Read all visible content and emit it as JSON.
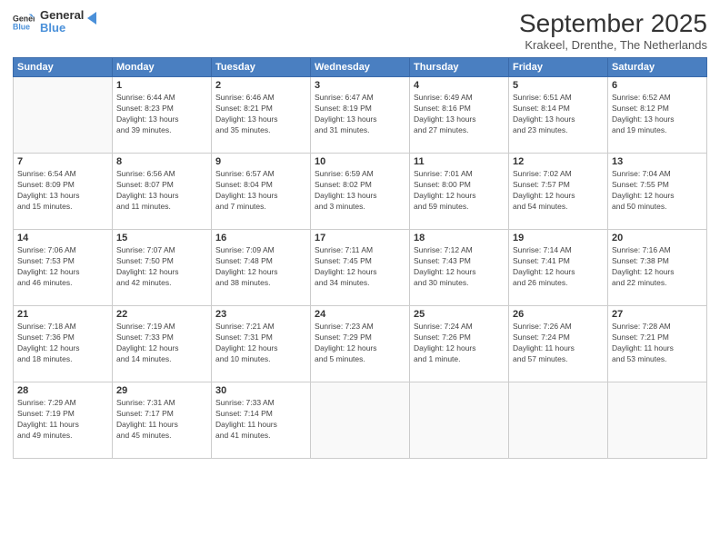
{
  "header": {
    "logo_line1": "General",
    "logo_line2": "Blue",
    "month": "September 2025",
    "location": "Krakeel, Drenthe, The Netherlands"
  },
  "days_of_week": [
    "Sunday",
    "Monday",
    "Tuesday",
    "Wednesday",
    "Thursday",
    "Friday",
    "Saturday"
  ],
  "weeks": [
    [
      {
        "day": "",
        "info": ""
      },
      {
        "day": "1",
        "info": "Sunrise: 6:44 AM\nSunset: 8:23 PM\nDaylight: 13 hours\nand 39 minutes."
      },
      {
        "day": "2",
        "info": "Sunrise: 6:46 AM\nSunset: 8:21 PM\nDaylight: 13 hours\nand 35 minutes."
      },
      {
        "day": "3",
        "info": "Sunrise: 6:47 AM\nSunset: 8:19 PM\nDaylight: 13 hours\nand 31 minutes."
      },
      {
        "day": "4",
        "info": "Sunrise: 6:49 AM\nSunset: 8:16 PM\nDaylight: 13 hours\nand 27 minutes."
      },
      {
        "day": "5",
        "info": "Sunrise: 6:51 AM\nSunset: 8:14 PM\nDaylight: 13 hours\nand 23 minutes."
      },
      {
        "day": "6",
        "info": "Sunrise: 6:52 AM\nSunset: 8:12 PM\nDaylight: 13 hours\nand 19 minutes."
      }
    ],
    [
      {
        "day": "7",
        "info": "Sunrise: 6:54 AM\nSunset: 8:09 PM\nDaylight: 13 hours\nand 15 minutes."
      },
      {
        "day": "8",
        "info": "Sunrise: 6:56 AM\nSunset: 8:07 PM\nDaylight: 13 hours\nand 11 minutes."
      },
      {
        "day": "9",
        "info": "Sunrise: 6:57 AM\nSunset: 8:04 PM\nDaylight: 13 hours\nand 7 minutes."
      },
      {
        "day": "10",
        "info": "Sunrise: 6:59 AM\nSunset: 8:02 PM\nDaylight: 13 hours\nand 3 minutes."
      },
      {
        "day": "11",
        "info": "Sunrise: 7:01 AM\nSunset: 8:00 PM\nDaylight: 12 hours\nand 59 minutes."
      },
      {
        "day": "12",
        "info": "Sunrise: 7:02 AM\nSunset: 7:57 PM\nDaylight: 12 hours\nand 54 minutes."
      },
      {
        "day": "13",
        "info": "Sunrise: 7:04 AM\nSunset: 7:55 PM\nDaylight: 12 hours\nand 50 minutes."
      }
    ],
    [
      {
        "day": "14",
        "info": "Sunrise: 7:06 AM\nSunset: 7:53 PM\nDaylight: 12 hours\nand 46 minutes."
      },
      {
        "day": "15",
        "info": "Sunrise: 7:07 AM\nSunset: 7:50 PM\nDaylight: 12 hours\nand 42 minutes."
      },
      {
        "day": "16",
        "info": "Sunrise: 7:09 AM\nSunset: 7:48 PM\nDaylight: 12 hours\nand 38 minutes."
      },
      {
        "day": "17",
        "info": "Sunrise: 7:11 AM\nSunset: 7:45 PM\nDaylight: 12 hours\nand 34 minutes."
      },
      {
        "day": "18",
        "info": "Sunrise: 7:12 AM\nSunset: 7:43 PM\nDaylight: 12 hours\nand 30 minutes."
      },
      {
        "day": "19",
        "info": "Sunrise: 7:14 AM\nSunset: 7:41 PM\nDaylight: 12 hours\nand 26 minutes."
      },
      {
        "day": "20",
        "info": "Sunrise: 7:16 AM\nSunset: 7:38 PM\nDaylight: 12 hours\nand 22 minutes."
      }
    ],
    [
      {
        "day": "21",
        "info": "Sunrise: 7:18 AM\nSunset: 7:36 PM\nDaylight: 12 hours\nand 18 minutes."
      },
      {
        "day": "22",
        "info": "Sunrise: 7:19 AM\nSunset: 7:33 PM\nDaylight: 12 hours\nand 14 minutes."
      },
      {
        "day": "23",
        "info": "Sunrise: 7:21 AM\nSunset: 7:31 PM\nDaylight: 12 hours\nand 10 minutes."
      },
      {
        "day": "24",
        "info": "Sunrise: 7:23 AM\nSunset: 7:29 PM\nDaylight: 12 hours\nand 5 minutes."
      },
      {
        "day": "25",
        "info": "Sunrise: 7:24 AM\nSunset: 7:26 PM\nDaylight: 12 hours\nand 1 minute."
      },
      {
        "day": "26",
        "info": "Sunrise: 7:26 AM\nSunset: 7:24 PM\nDaylight: 11 hours\nand 57 minutes."
      },
      {
        "day": "27",
        "info": "Sunrise: 7:28 AM\nSunset: 7:21 PM\nDaylight: 11 hours\nand 53 minutes."
      }
    ],
    [
      {
        "day": "28",
        "info": "Sunrise: 7:29 AM\nSunset: 7:19 PM\nDaylight: 11 hours\nand 49 minutes."
      },
      {
        "day": "29",
        "info": "Sunrise: 7:31 AM\nSunset: 7:17 PM\nDaylight: 11 hours\nand 45 minutes."
      },
      {
        "day": "30",
        "info": "Sunrise: 7:33 AM\nSunset: 7:14 PM\nDaylight: 11 hours\nand 41 minutes."
      },
      {
        "day": "",
        "info": ""
      },
      {
        "day": "",
        "info": ""
      },
      {
        "day": "",
        "info": ""
      },
      {
        "day": "",
        "info": ""
      }
    ]
  ]
}
